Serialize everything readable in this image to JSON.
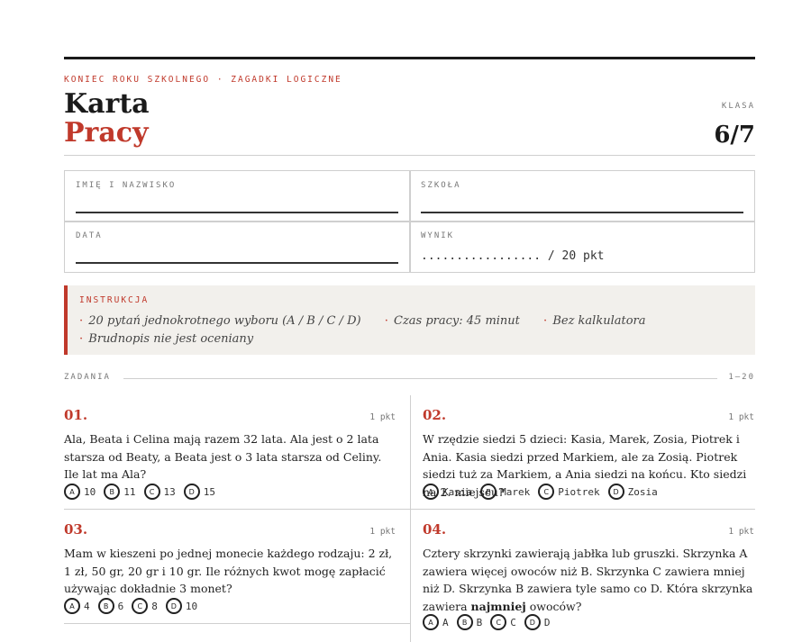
{
  "header": {
    "kicker": "KONIEC ROKU SZKOLNEGO · ZAGADKI LOGICZNE",
    "title_line1": "Karta",
    "title_line2": "Pracy",
    "klasa_label": "KLASA",
    "klasa_value": "6/7"
  },
  "fields": {
    "name_label": "IMIĘ I NAZWISKO",
    "school_label": "SZKOŁA",
    "date_label": "DATA",
    "score_label": "WYNIK",
    "score_value": "................. / 20 pkt"
  },
  "instructions": {
    "label": "INSTRUKCJA",
    "items": [
      "20 pytań jednokrotnego wyboru (A / B / C / D)",
      "Czas pracy: 45 minut",
      "Bez kalkulatora",
      "Brudnopis nie jest oceniany"
    ]
  },
  "section": {
    "label": "ZADANIA",
    "range": "1–20"
  },
  "questions": [
    {
      "num": "01.",
      "points": "1 pkt",
      "text": "Ala, Beata i Celina mają razem 32 lata. Ala jest o 2 lata starsza od Beaty, a Beata jest o 3 lata starsza od Celiny. Ile lat ma Ala?",
      "options": [
        {
          "letter": "A",
          "value": "10"
        },
        {
          "letter": "B",
          "value": "11"
        },
        {
          "letter": "C",
          "value": "13"
        },
        {
          "letter": "D",
          "value": "15"
        }
      ]
    },
    {
      "num": "02.",
      "points": "1 pkt",
      "text": "W rzędzie siedzi 5 dzieci: Kasia, Marek, Zosia, Piotrek i Ania. Kasia siedzi przed Markiem, ale za Zosią. Piotrek siedzi tuż za Markiem, a Ania siedzi na końcu. Kto siedzi na 2. miejscu?",
      "options": [
        {
          "letter": "A",
          "value": "Kasia"
        },
        {
          "letter": "B",
          "value": "Marek"
        },
        {
          "letter": "C",
          "value": "Piotrek"
        },
        {
          "letter": "D",
          "value": "Zosia"
        }
      ]
    },
    {
      "num": "03.",
      "points": "1 pkt",
      "text": "Mam w kieszeni po jednej monecie każdego rodzaju: 2 zł, 1 zł, 50 gr, 20 gr i 10 gr. Ile różnych kwot mogę zapłacić używając dokładnie 3 monet?",
      "options": [
        {
          "letter": "A",
          "value": "4"
        },
        {
          "letter": "B",
          "value": "6"
        },
        {
          "letter": "C",
          "value": "8"
        },
        {
          "letter": "D",
          "value": "10"
        }
      ]
    },
    {
      "num": "04.",
      "points": "1 pkt",
      "text_before": "Cztery skrzynki zawierają jabłka lub gruszki. Skrzynka A zawiera więcej owoców niż B. Skrzynka C zawiera mniej niż D. Skrzynka B zawiera tyle samo co D. Która skrzynka zawiera ",
      "text_bold": "najmniej",
      "text_after": " owoców?",
      "options": [
        {
          "letter": "A",
          "value": "A"
        },
        {
          "letter": "B",
          "value": "B"
        },
        {
          "letter": "C",
          "value": "C"
        },
        {
          "letter": "D",
          "value": "D"
        }
      ]
    }
  ],
  "colors": {
    "accent": "#c0392b",
    "rule": "#1a1a1a",
    "panel": "#f2f0ec"
  }
}
